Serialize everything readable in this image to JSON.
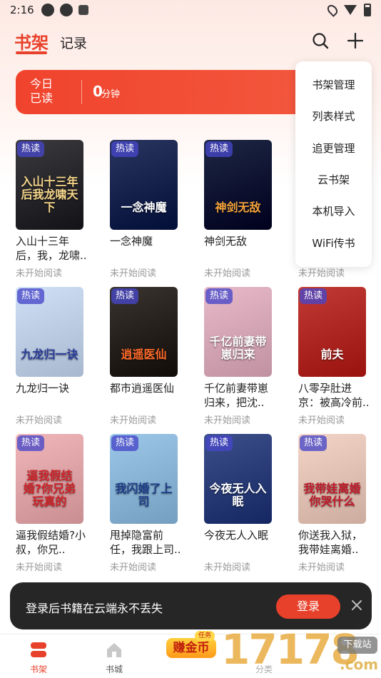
{
  "status_bar": {
    "time": "2:16"
  },
  "header": {
    "tab_shelf": "书架",
    "tab_history": "记录"
  },
  "reading": {
    "label": "今日已读",
    "value": "0",
    "unit": "分钟"
  },
  "menu": {
    "items": [
      "书架管理",
      "列表样式",
      "追更管理",
      "云书架",
      "本机导入",
      "WiFi传书"
    ]
  },
  "books": [
    {
      "title": "入山十三年后，我，龙啸..",
      "status": "未开始阅读",
      "badge": "热读",
      "cover_text": "入山十三年后我龙啸天下",
      "cover_bg": "#3b3a3e",
      "cover_fg": "#f6d68a"
    },
    {
      "title": "一念神魔",
      "status": "未开始阅读",
      "badge": "热读",
      "cover_text": "一念神魔",
      "cover_bg": "#2a3560",
      "cover_fg": "#ffffff"
    },
    {
      "title": "神剑无敌",
      "status": "未开始阅读",
      "badge": "热读",
      "cover_text": "神剑无敌",
      "cover_bg": "#1d2745",
      "cover_fg": "#f2a23a"
    },
    {
      "title": "",
      "status": "未开始阅读",
      "badge": "热读",
      "cover_text": "",
      "cover_bg": "#3c4860",
      "cover_fg": "#ffffff"
    },
    {
      "title": "九龙归一诀",
      "status": "未开始阅读",
      "badge": "热读",
      "cover_text": "九龙归一诀",
      "cover_bg": "#cfe0f7",
      "cover_fg": "#2b3d9c"
    },
    {
      "title": "都市逍遥医仙",
      "status": "未开始阅读",
      "badge": "热读",
      "cover_text": "逍遥医仙",
      "cover_bg": "#3a3430",
      "cover_fg": "#ff6a2a"
    },
    {
      "title": "千亿前妻带崽归来，把沈..",
      "status": "未开始阅读",
      "badge": "热读",
      "cover_text": "千亿前妻带崽归来",
      "cover_bg": "#e8b9c9",
      "cover_fg": "#ffffff"
    },
    {
      "title": "八零孕肚进京：被高冷前..",
      "status": "未开始阅读",
      "badge": "热读",
      "cover_text": "前夫",
      "cover_bg": "#c23a35",
      "cover_fg": "#ffffff"
    },
    {
      "title": "逼我假结婚?小叔，你兄..",
      "status": "未开始阅读",
      "badge": "热读",
      "cover_text": "逼我假结婚?你兄弟玩真的",
      "cover_bg": "#f0b6b9",
      "cover_fg": "#d02328"
    },
    {
      "title": "甩掉隐富前任，我跟上司..",
      "status": "未开始阅读",
      "badge": "热读",
      "cover_text": "我闪婚了上司",
      "cover_bg": "#9cc7e8",
      "cover_fg": "#1d3f8c"
    },
    {
      "title": "今夜无人入眠",
      "status": "未开始阅读",
      "badge": "热读",
      "cover_text": "今夜无人入眠",
      "cover_bg": "#3c4f8a",
      "cover_fg": "#ffffff"
    },
    {
      "title": "你送我入狱，我带娃离婚..",
      "status": "未开始阅读",
      "badge": "热读",
      "cover_text": "我带娃离婚你哭什么",
      "cover_bg": "#f4d4c6",
      "cover_fg": "#c21b2b"
    }
  ],
  "toast": {
    "message": "登录后书籍在云端永不丢失",
    "login_label": "登录"
  },
  "nav": {
    "shelf": "书架",
    "store": "书城",
    "earn": "赚金币",
    "earn_tag": "任务",
    "hidden": "分类"
  },
  "watermark": {
    "text": "17178",
    "tag": "下载站",
    "sub": ".com"
  },
  "colors": {
    "accent": "#e8412b",
    "badge": "#4646c8",
    "toast": "#262626"
  }
}
